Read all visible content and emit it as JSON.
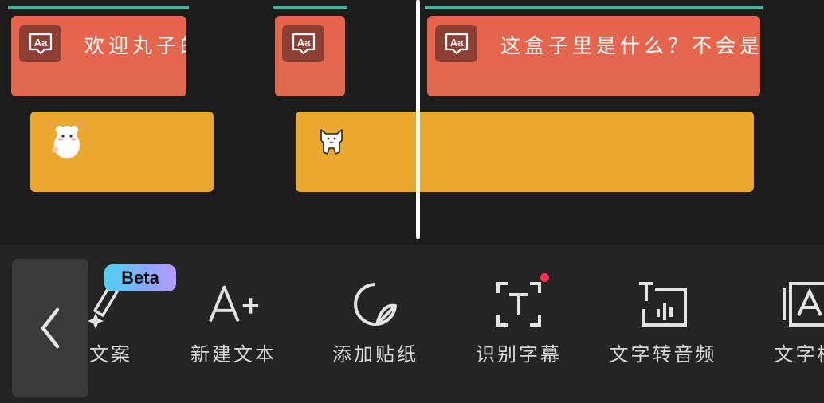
{
  "timeline": {
    "text_clips": [
      {
        "text": "欢迎丸子的"
      },
      {
        "text": ""
      },
      {
        "text": "这盒子里是什么？不会是"
      }
    ],
    "text_clip_icon": "text-aa-icon",
    "sticker_clips": [
      {
        "sticker": "sheep-sticker-icon"
      },
      {
        "sticker": "white-dog-sticker-icon"
      }
    ]
  },
  "toolbar": {
    "back_icon": "chevron-left-icon",
    "beta_badge": "Beta",
    "tools": [
      {
        "label": "文案",
        "icon": "magic-wand-icon"
      },
      {
        "label": "新建文本",
        "icon": "text-plus-icon"
      },
      {
        "label": "添加贴纸",
        "icon": "sticker-icon"
      },
      {
        "label": "识别字幕",
        "icon": "scan-text-icon"
      },
      {
        "label": "文字转音频",
        "icon": "text-to-audio-icon"
      },
      {
        "label": "文字模",
        "icon": "text-template-icon"
      }
    ]
  },
  "colors": {
    "text_clip": "#e8634c",
    "sticker_clip": "#eba82e",
    "track_top_line": "#3fb5a0",
    "new_dot": "#ff2c55"
  }
}
